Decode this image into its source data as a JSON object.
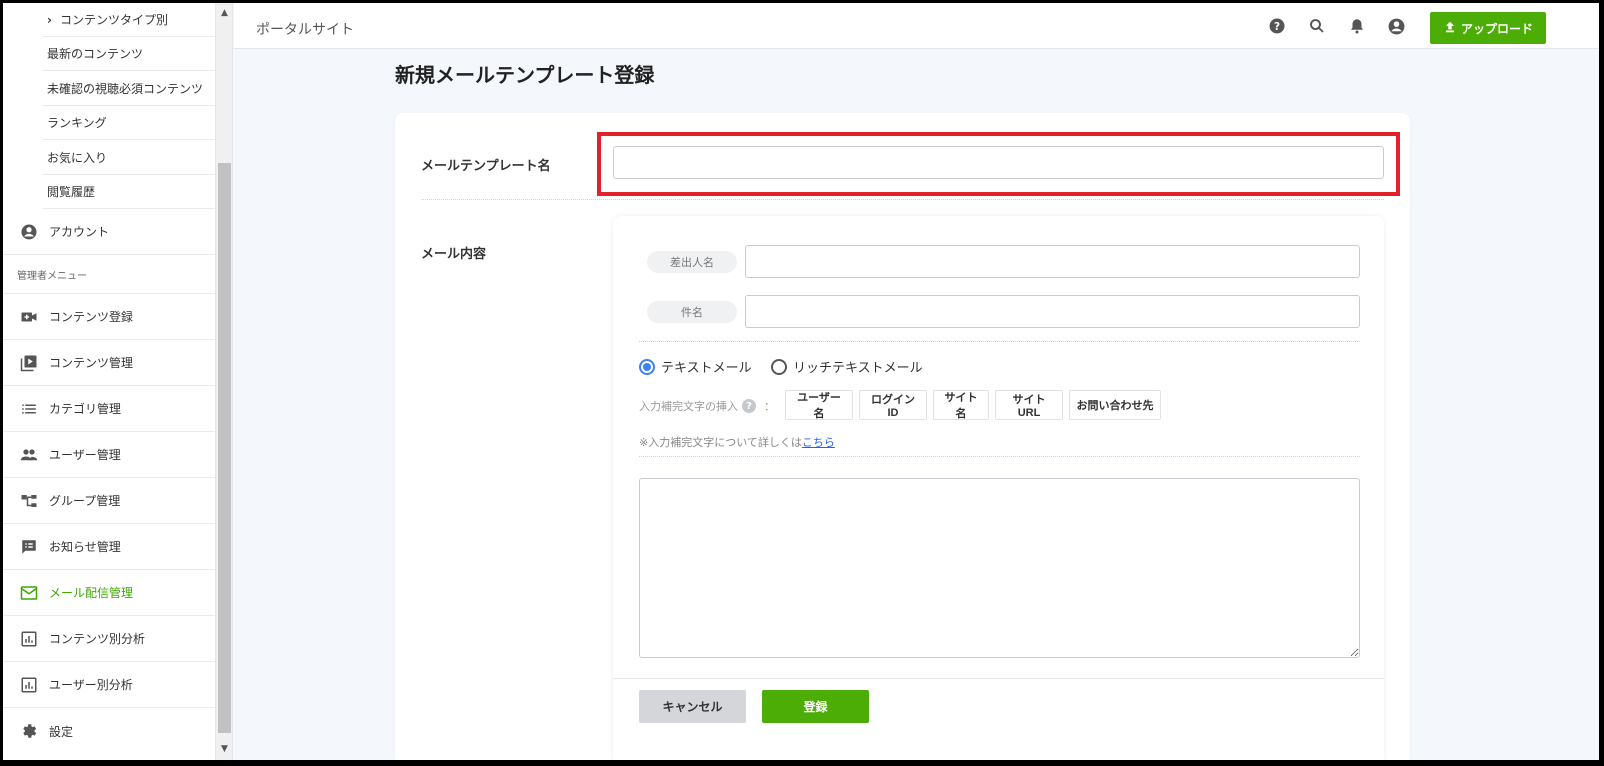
{
  "sidebar": {
    "sub_items": [
      {
        "label": "コンテンツタイプ別",
        "has_chevron": true
      },
      {
        "label": "最新のコンテンツ"
      },
      {
        "label": "未確認の視聴必須コンテンツ"
      },
      {
        "label": "ランキング"
      },
      {
        "label": "お気に入り"
      },
      {
        "label": "閲覧履歴"
      }
    ],
    "account_label": "アカウント",
    "admin_section_label": "管理者メニュー",
    "admin_items": [
      {
        "label": "コンテンツ登録",
        "icon": "video-add-icon"
      },
      {
        "label": "コンテンツ管理",
        "icon": "video-library-icon"
      },
      {
        "label": "カテゴリ管理",
        "icon": "list-icon"
      },
      {
        "label": "ユーザー管理",
        "icon": "people-icon"
      },
      {
        "label": "グループ管理",
        "icon": "tree-icon"
      },
      {
        "label": "お知らせ管理",
        "icon": "announcement-icon"
      },
      {
        "label": "メール配信管理",
        "icon": "mail-icon",
        "active": true
      },
      {
        "label": "コンテンツ別分析",
        "icon": "chart-icon"
      },
      {
        "label": "ユーザー別分析",
        "icon": "chart-icon"
      },
      {
        "label": "設定",
        "icon": "gear-icon"
      }
    ]
  },
  "header": {
    "site_name": "ポータルサイト",
    "upload_label": "アップロード"
  },
  "main": {
    "title": "新規メールテンプレート登録",
    "template_name_label": "メールテンプレート名",
    "template_name_value": "",
    "mail_content_label": "メール内容",
    "sender_label": "差出人名",
    "sender_value": "",
    "subject_label": "件名",
    "subject_value": "",
    "format_options": [
      {
        "label": "テキストメール",
        "selected": true
      },
      {
        "label": "リッチテキストメール",
        "selected": false
      }
    ],
    "insert_label": "入力補完文字の挿入",
    "insert_help": "?",
    "insert_colon": "：",
    "insert_tags": [
      "ユーザー名",
      "ログインID",
      "サイト名",
      "サイトURL",
      "お問い合わせ先"
    ],
    "note_text": "※入力補完文字について詳しくは",
    "note_link": "こちら",
    "cancel_label": "キャンセル",
    "submit_label": "登録"
  },
  "colors": {
    "accent_green": "#4cad06",
    "highlight_red": "#e2212b",
    "radio_blue": "#3b82f6"
  }
}
